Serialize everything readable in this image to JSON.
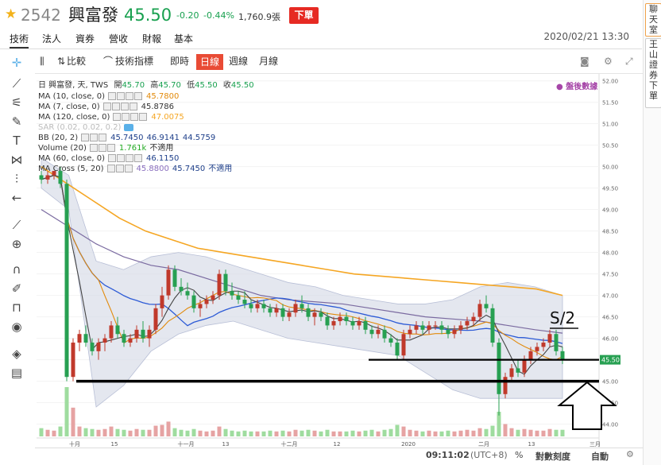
{
  "header": {
    "star_icon": "star-icon",
    "code": "2542",
    "name": "興富發",
    "price": "45.50",
    "change": "-0.20",
    "change_pct": "-0.44%",
    "volume": "1,760.9張",
    "order_button": "下單",
    "price_color": "#18a04f"
  },
  "tabs": [
    "技術",
    "法人",
    "資券",
    "營收",
    "財報",
    "基本"
  ],
  "datetime": "2020/02/21 13:30",
  "right_side": {
    "btn1": "聊天室",
    "btn2": "王山證券下單"
  },
  "left_tools": [
    "crosshair-icon",
    "line-icon",
    "fib-icon",
    "brush-icon",
    "text-icon",
    "pattern-icon",
    "fork-icon",
    "back-icon",
    "ruler-icon",
    "zoom-icon",
    "magnet-icon",
    "lock-draw-icon",
    "unlock-icon",
    "eye-icon",
    "layers-icon",
    "trash-icon"
  ],
  "toolbar": {
    "compare": "比較",
    "indicators": "技術指標",
    "intraday": "即時",
    "daily": "日線",
    "weekly": "週線",
    "monthly": "月線"
  },
  "legend": {
    "main": "日 興富發, 天, TWS",
    "ohlc": {
      "open_label": "開",
      "open": "45.70",
      "high_label": "高",
      "high": "45.70",
      "low_label": "低",
      "low": "45.50",
      "close_label": "收",
      "close": "45.50"
    },
    "ma10": {
      "label": "MA (10, close, 0)",
      "value": "45.7800",
      "color": "#e28a0a"
    },
    "ma7": {
      "label": "MA (7, close, 0)",
      "value": "45.8786",
      "color": "#333333"
    },
    "ma120": {
      "label": "MA (120, close, 0)",
      "value": "47.0075",
      "color": "#f5a623"
    },
    "sar": {
      "label": "SAR (0.02, 0.02, 0.2)"
    },
    "bb": {
      "label": "BB (20, 2)",
      "v1": "45.7450",
      "v2": "46.9141",
      "v3": "44.5759",
      "color": "#1e3f8a"
    },
    "volume": {
      "label": "Volume (20)",
      "value": "1.761k",
      "na": "不適用",
      "color": "#22aa22"
    },
    "ma60": {
      "label": "MA (60, close, 0)",
      "value": "46.1150",
      "color": "#1e3f8a"
    },
    "macross": {
      "label": "MA Cross (5, 20)",
      "v1": "45.8800",
      "v2": "45.7450",
      "na": "不適用"
    }
  },
  "after_hours": "盤後數據",
  "annotation": "S/2",
  "footer": {
    "time": "09:11:02",
    "tz": "(UTC+8)",
    "pct": "%",
    "log": "對數刻度",
    "auto": "自動"
  },
  "colors": {
    "up": "#c0392b",
    "down": "#27a052",
    "bb_fill": "#d9dde8",
    "vol_up": "#e6a3a3",
    "vol_down": "#9fdc9f"
  },
  "chart_data": {
    "type": "candlestick",
    "y_ticks": [
      "52.00",
      "51.50",
      "51.00",
      "50.50",
      "50.00",
      "49.50",
      "49.00",
      "48.50",
      "48.00",
      "47.50",
      "47.00",
      "46.50",
      "46.00",
      "45.50",
      "45.00",
      "44.50",
      "44.00"
    ],
    "ylim": [
      43.9,
      52.05
    ],
    "x_ticks": [
      "十月",
      "15",
      "十一月",
      "13",
      "十二月",
      "12",
      "2020",
      "二月",
      "13",
      "三月"
    ],
    "last_price_label": "45.50",
    "candles": [
      [
        49.8,
        49.9,
        49.6,
        49.7
      ],
      [
        49.7,
        49.9,
        49.6,
        49.8
      ],
      [
        49.8,
        49.9,
        49.7,
        49.9
      ],
      [
        49.9,
        50.0,
        49.5,
        49.6
      ],
      [
        49.6,
        49.7,
        45.0,
        45.1
      ],
      [
        45.1,
        46.0,
        45.0,
        45.9
      ],
      [
        45.9,
        46.2,
        45.7,
        46.1
      ],
      [
        46.1,
        46.3,
        45.8,
        45.9
      ],
      [
        45.9,
        46.0,
        45.6,
        45.7
      ],
      [
        45.7,
        46.0,
        45.5,
        45.9
      ],
      [
        45.9,
        46.1,
        45.7,
        46.0
      ],
      [
        46.0,
        46.4,
        45.9,
        46.3
      ],
      [
        46.3,
        46.5,
        46.0,
        46.1
      ],
      [
        46.1,
        46.2,
        45.8,
        45.9
      ],
      [
        45.9,
        46.1,
        45.8,
        46.0
      ],
      [
        46.0,
        46.3,
        45.9,
        46.2
      ],
      [
        46.2,
        46.4,
        45.9,
        46.0
      ],
      [
        46.0,
        46.3,
        45.8,
        46.2
      ],
      [
        46.2,
        46.8,
        46.1,
        46.7
      ],
      [
        46.7,
        47.2,
        46.5,
        47.0
      ],
      [
        47.0,
        47.7,
        46.9,
        47.6
      ],
      [
        47.6,
        47.7,
        47.1,
        47.2
      ],
      [
        47.2,
        47.4,
        47.0,
        47.1
      ],
      [
        47.1,
        47.3,
        46.9,
        47.0
      ],
      [
        47.0,
        47.1,
        46.6,
        46.7
      ],
      [
        46.7,
        46.9,
        46.5,
        46.8
      ],
      [
        46.8,
        47.0,
        46.7,
        46.9
      ],
      [
        46.9,
        47.1,
        46.8,
        47.0
      ],
      [
        47.0,
        47.6,
        46.9,
        47.5
      ],
      [
        47.5,
        47.6,
        47.0,
        47.1
      ],
      [
        47.1,
        47.3,
        46.9,
        47.0
      ],
      [
        47.0,
        47.1,
        46.8,
        46.9
      ],
      [
        46.9,
        47.1,
        46.7,
        46.8
      ],
      [
        46.8,
        46.9,
        46.6,
        46.7
      ],
      [
        46.7,
        46.9,
        46.6,
        46.8
      ],
      [
        46.8,
        46.9,
        46.6,
        46.7
      ],
      [
        46.7,
        46.8,
        46.5,
        46.6
      ],
      [
        46.6,
        46.8,
        46.5,
        46.7
      ],
      [
        46.7,
        46.8,
        46.4,
        46.5
      ],
      [
        46.5,
        46.7,
        46.4,
        46.6
      ],
      [
        46.6,
        46.9,
        46.5,
        46.8
      ],
      [
        46.8,
        47.0,
        46.6,
        46.7
      ],
      [
        46.7,
        46.8,
        46.4,
        46.5
      ],
      [
        46.5,
        46.7,
        46.3,
        46.6
      ],
      [
        46.6,
        46.7,
        46.4,
        46.5
      ],
      [
        46.5,
        46.6,
        46.2,
        46.3
      ],
      [
        46.3,
        46.5,
        46.2,
        46.4
      ],
      [
        46.4,
        46.6,
        46.3,
        46.5
      ],
      [
        46.5,
        46.6,
        46.3,
        46.4
      ],
      [
        46.4,
        46.5,
        46.2,
        46.3
      ],
      [
        46.3,
        46.5,
        46.2,
        46.4
      ],
      [
        46.4,
        46.5,
        46.1,
        46.2
      ],
      [
        46.2,
        46.3,
        46.0,
        46.1
      ],
      [
        46.1,
        46.3,
        46.0,
        46.2
      ],
      [
        46.2,
        46.3,
        45.9,
        46.0
      ],
      [
        46.0,
        46.1,
        45.8,
        45.9
      ],
      [
        45.9,
        46.0,
        45.5,
        45.6
      ],
      [
        45.6,
        46.2,
        45.5,
        46.1
      ],
      [
        46.1,
        46.3,
        46.0,
        46.2
      ],
      [
        46.2,
        46.4,
        46.1,
        46.3
      ],
      [
        46.3,
        46.4,
        46.1,
        46.2
      ],
      [
        46.2,
        46.4,
        46.1,
        46.3
      ],
      [
        46.3,
        46.4,
        46.2,
        46.3
      ],
      [
        46.3,
        46.4,
        46.1,
        46.2
      ],
      [
        46.2,
        46.3,
        46.0,
        46.1
      ],
      [
        46.1,
        46.3,
        46.0,
        46.2
      ],
      [
        46.2,
        46.4,
        46.1,
        46.3
      ],
      [
        46.3,
        46.5,
        46.2,
        46.4
      ],
      [
        46.4,
        46.6,
        46.3,
        46.5
      ],
      [
        46.5,
        46.9,
        46.4,
        46.8
      ],
      [
        46.8,
        47.0,
        46.6,
        46.7
      ],
      [
        46.7,
        46.8,
        45.8,
        45.9
      ],
      [
        45.9,
        46.0,
        44.2,
        44.7
      ],
      [
        44.7,
        45.2,
        44.6,
        45.1
      ],
      [
        45.1,
        45.4,
        45.0,
        45.3
      ],
      [
        45.3,
        45.5,
        45.1,
        45.2
      ],
      [
        45.2,
        45.6,
        45.1,
        45.5
      ],
      [
        45.5,
        45.8,
        45.4,
        45.7
      ],
      [
        45.7,
        45.9,
        45.6,
        45.8
      ],
      [
        45.8,
        46.0,
        45.7,
        45.9
      ],
      [
        45.9,
        46.2,
        45.8,
        46.1
      ],
      [
        46.1,
        46.2,
        45.6,
        45.7
      ],
      [
        45.7,
        45.8,
        45.4,
        45.5
      ]
    ],
    "volumes": [
      1.0,
      0.8,
      0.7,
      1.2,
      6.0,
      3.5,
      1.2,
      1.0,
      0.9,
      0.8,
      0.9,
      1.2,
      0.9,
      0.8,
      0.7,
      0.9,
      0.8,
      0.8,
      1.3,
      1.4,
      1.8,
      1.0,
      0.8,
      0.7,
      0.9,
      0.7,
      0.6,
      0.7,
      1.2,
      0.9,
      0.7,
      0.6,
      0.7,
      0.6,
      0.6,
      0.6,
      0.7,
      0.6,
      0.7,
      0.6,
      0.8,
      0.7,
      0.8,
      0.7,
      0.6,
      0.8,
      0.6,
      0.6,
      0.6,
      0.7,
      0.6,
      0.7,
      0.8,
      0.6,
      0.8,
      0.9,
      1.4,
      1.2,
      0.8,
      0.7,
      0.6,
      0.7,
      0.6,
      0.6,
      0.7,
      0.6,
      0.7,
      0.8,
      0.7,
      1.0,
      0.9,
      1.3,
      3.0,
      1.5,
      1.0,
      0.8,
      0.9,
      0.8,
      0.7,
      0.7,
      0.9,
      0.8,
      0.8
    ],
    "ma120": [
      50.0,
      49.6,
      49.2,
      48.8,
      48.5,
      48.3,
      48.1,
      48.0,
      47.9,
      47.8,
      47.7,
      47.6,
      47.5,
      47.45,
      47.4,
      47.35,
      47.3,
      47.25,
      47.2,
      47.15,
      47.0
    ],
    "ma60": [
      49.0,
      48.6,
      48.2,
      47.9,
      47.7,
      47.6,
      47.4,
      47.2,
      47.0,
      46.9,
      46.85,
      46.8,
      46.7,
      46.6,
      46.5,
      46.45,
      46.4,
      46.3,
      46.2,
      46.12
    ],
    "bb_upper": [
      50.2,
      49.8,
      47.8,
      47.6,
      47.9,
      48.0,
      47.9,
      47.7,
      47.5,
      47.3,
      47.2,
      47.0,
      46.9,
      46.8,
      46.8,
      46.9,
      47.2,
      47.3,
      47.2,
      47.0
    ],
    "bb_lower": [
      49.5,
      49.0,
      44.4,
      44.9,
      45.7,
      46.1,
      46.3,
      46.4,
      46.2,
      46.0,
      45.9,
      45.8,
      45.7,
      45.6,
      45.2,
      44.8,
      44.6,
      44.6,
      44.6,
      44.6
    ],
    "support_lines": [
      45.5,
      45.0
    ],
    "annotation_arrow": "up-arrow"
  }
}
